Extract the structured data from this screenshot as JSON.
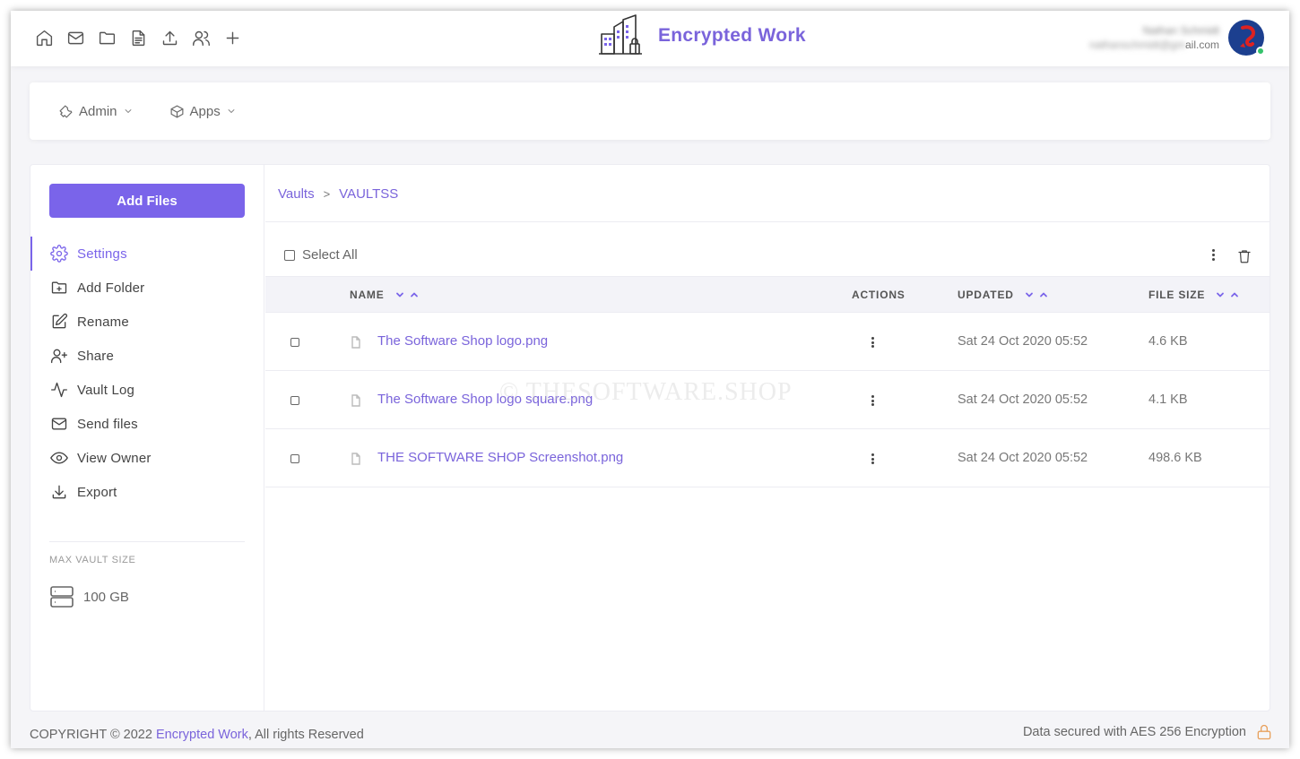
{
  "topbar": {
    "icons": [
      "home-icon",
      "mail-icon",
      "folder-icon",
      "file-text-icon",
      "upload-icon",
      "users-icon",
      "plus-icon"
    ],
    "brand_title": "Encrypted Work",
    "user_name": "Nathan Schmidt",
    "user_email_visible": "ail.com",
    "user_email_blurred": "nathanschmidt@gm"
  },
  "menubar": {
    "items": [
      {
        "label": "Admin",
        "icon": "wrench-icon"
      },
      {
        "label": "Apps",
        "icon": "box-icon"
      }
    ]
  },
  "sidebar": {
    "add_files": "Add Files",
    "items": [
      {
        "label": "Settings",
        "icon": "gear-icon",
        "active": true
      },
      {
        "label": "Add Folder",
        "icon": "folder-plus-icon"
      },
      {
        "label": "Rename",
        "icon": "edit-icon"
      },
      {
        "label": "Share",
        "icon": "user-plus-icon"
      },
      {
        "label": "Vault Log",
        "icon": "activity-icon"
      },
      {
        "label": "Send files",
        "icon": "mail-icon"
      },
      {
        "label": "View Owner",
        "icon": "eye-icon"
      },
      {
        "label": "Export",
        "icon": "download-icon"
      }
    ],
    "max_vault_label": "MAX VAULT SIZE",
    "max_vault_value": "100 GB"
  },
  "breadcrumb": {
    "items": [
      "Vaults",
      "VAULTSS"
    ],
    "separator": ">"
  },
  "toolbar": {
    "select_all": "Select All"
  },
  "table": {
    "headers": {
      "name": "NAME",
      "actions": "ACTIONS",
      "updated": "UPDATED",
      "file_size": "FILE SIZE"
    },
    "rows": [
      {
        "name": "The Software Shop logo.png",
        "updated": "Sat 24 Oct 2020 05:52",
        "size": "4.6 KB"
      },
      {
        "name": "The Software Shop logo square.png",
        "updated": "Sat 24 Oct 2020 05:52",
        "size": "4.1 KB"
      },
      {
        "name": "THE SOFTWARE SHOP Screenshot.png",
        "updated": "Sat 24 Oct 2020 05:52",
        "size": "498.6 KB"
      }
    ]
  },
  "watermark": "© THESOFTWARE.SHOP",
  "footer": {
    "copyright_prefix": "COPYRIGHT © 2022 ",
    "copyright_brand": "Encrypted Work",
    "copyright_suffix": ", All rights Reserved",
    "security_note": "Data secured with AES 256 Encryption"
  },
  "colors": {
    "accent": "#7a64ea",
    "lock": "#e8a15e"
  }
}
